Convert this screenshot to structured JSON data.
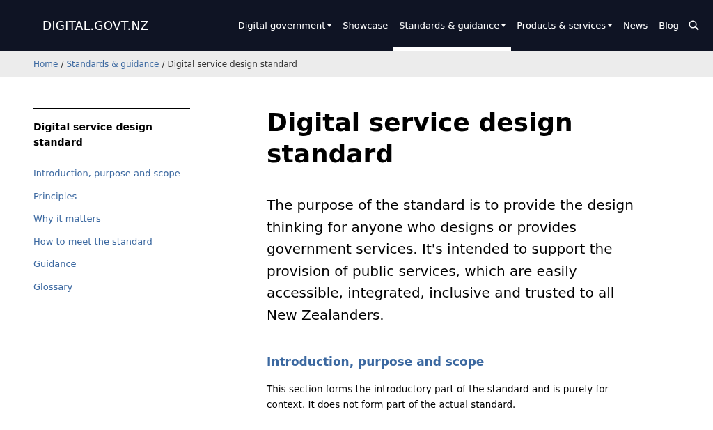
{
  "header": {
    "logo": "DIGITAL.GOVT.NZ",
    "nav": [
      {
        "label": "Digital government",
        "has_menu": true,
        "selected": false
      },
      {
        "label": "Showcase",
        "has_menu": false,
        "selected": false
      },
      {
        "label": "Standards & guidance",
        "has_menu": true,
        "selected": true
      },
      {
        "label": "Products & services",
        "has_menu": true,
        "selected": false
      },
      {
        "label": "News",
        "has_menu": false,
        "selected": false
      },
      {
        "label": "Blog",
        "has_menu": false,
        "selected": false
      }
    ]
  },
  "breadcrumb": {
    "separator": "/",
    "items": [
      {
        "label": "Home",
        "kind": "link"
      },
      {
        "label": "Standards & guidance",
        "kind": "link"
      },
      {
        "label": "Digital service design standard",
        "kind": "current"
      }
    ]
  },
  "sidebar": {
    "title": "Digital service design standard",
    "items": [
      "Introduction, purpose and scope",
      "Principles",
      "Why it matters",
      "How to meet the standard",
      "Guidance",
      "Glossary"
    ]
  },
  "main": {
    "title": "Digital service design standard",
    "lead": "The purpose of the standard is to provide the design thinking for anyone who designs or provides government services. It's intended to support the provision of public services, which are easily accessible, integrated, inclusive and trusted to all New Zealanders.",
    "section_heading": "Introduction, purpose and scope",
    "section_text": "This section forms the introductory part of the standard and is purely for context. It does not form part of the actual standard."
  }
}
